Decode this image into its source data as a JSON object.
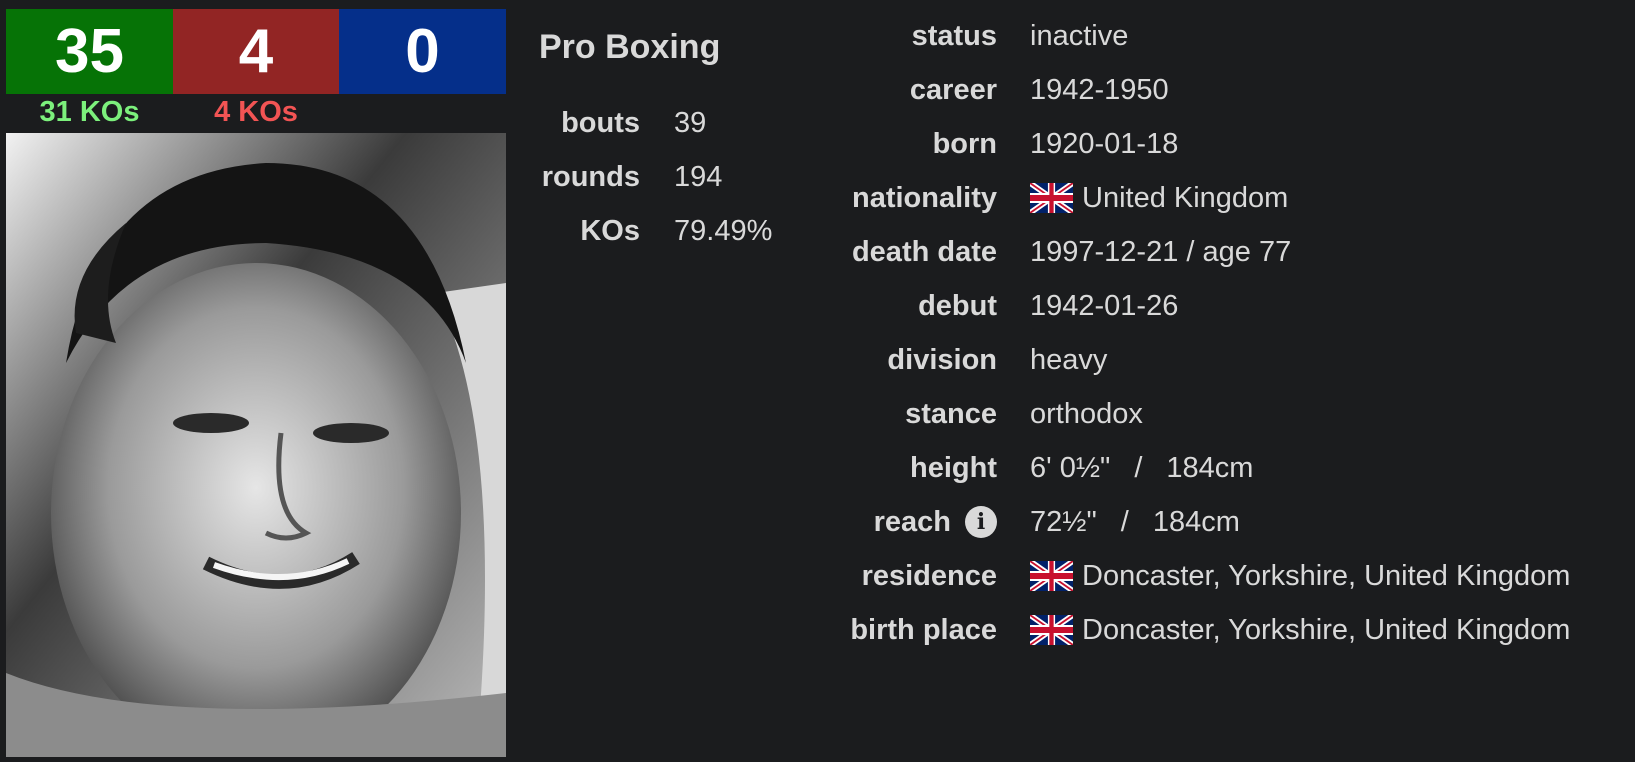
{
  "record": {
    "wins": "35",
    "losses": "4",
    "draws": "0",
    "win_kos": "31 KOs",
    "loss_kos": "4 KOs",
    "colors": {
      "win": "#067306",
      "loss": "#922524",
      "draw": "#052f8a"
    }
  },
  "pro": {
    "title": "Pro Boxing",
    "stats": [
      {
        "label": "bouts",
        "value": "39"
      },
      {
        "label": "rounds",
        "value": "194"
      },
      {
        "label": "KOs",
        "value": "79.49%"
      }
    ]
  },
  "bio": {
    "status": {
      "label": "status",
      "value": "inactive"
    },
    "career": {
      "label": "career",
      "value": "1942-1950"
    },
    "born": {
      "label": "born",
      "value": "1920-01-18"
    },
    "nationality": {
      "label": "nationality",
      "value": "United Kingdom",
      "icon": "uk-flag-icon"
    },
    "death_date": {
      "label": "death date",
      "value": "1997-12-21 / age 77"
    },
    "debut": {
      "label": "debut",
      "value": "1942-01-26"
    },
    "division": {
      "label": "division",
      "value": "heavy"
    },
    "stance": {
      "label": "stance",
      "value": "orthodox"
    },
    "height": {
      "label": "height",
      "imperial": "6' 0½\"",
      "sep": "/",
      "metric": "184cm"
    },
    "reach": {
      "label": "reach",
      "icon": "info-icon",
      "icon_glyph": "i",
      "imperial": "72½\"",
      "sep": "/",
      "metric": "184cm"
    },
    "residence": {
      "label": "residence",
      "value": "Doncaster, Yorkshire, United Kingdom",
      "icon": "uk-flag-icon"
    },
    "birth_place": {
      "label": "birth place",
      "value": "Doncaster, Yorkshire, United Kingdom",
      "icon": "uk-flag-icon"
    }
  }
}
